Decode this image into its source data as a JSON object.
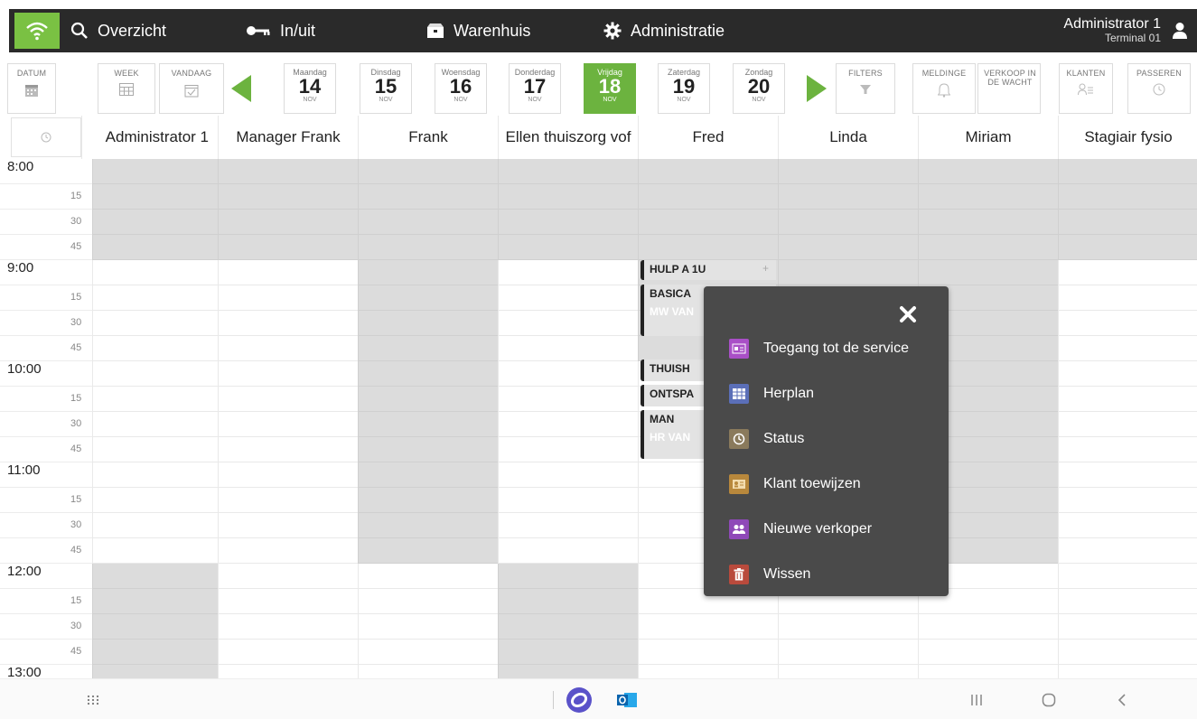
{
  "nav": {
    "items": [
      {
        "label": "Overzicht",
        "icon": "search-icon"
      },
      {
        "label": "In/uit",
        "icon": "key-icon"
      },
      {
        "label": "Warenhuis",
        "icon": "box-icon"
      },
      {
        "label": "Administratie",
        "icon": "gear-icon"
      }
    ],
    "user_name": "Administrator 1",
    "terminal": "Terminal 01"
  },
  "toolbar": {
    "datum": "DATUM",
    "week": "WEEK",
    "vandaag": "VANDAAG",
    "filters": "FILTERS",
    "meldingen": "MELDINGE",
    "verkoop": "VERKOOP IN DE WACHT",
    "klanten": "KLANTEN",
    "passeren": "PASSEREN"
  },
  "days": [
    {
      "name": "Maandag",
      "num": "14",
      "month": "NOV"
    },
    {
      "name": "Dinsdag",
      "num": "15",
      "month": "NOV"
    },
    {
      "name": "Woensdag",
      "num": "16",
      "month": "NOV"
    },
    {
      "name": "Donderdag",
      "num": "17",
      "month": "NOV"
    },
    {
      "name": "Vrijdag",
      "num": "18",
      "month": "NOV",
      "active": true
    },
    {
      "name": "Zaterdag",
      "num": "19",
      "month": "NOV"
    },
    {
      "name": "Zondag",
      "num": "20",
      "month": "NOV"
    }
  ],
  "columns": [
    "Administrator 1",
    "Manager Frank",
    "Frank",
    "Ellen thuiszorg vof",
    "Fred",
    "Linda",
    "Miriam",
    "Stagiair fysio"
  ],
  "hours": [
    "8:00",
    "9:00",
    "10:00",
    "11:00",
    "12:00",
    "13:00"
  ],
  "quarters": [
    "15",
    "30",
    "45"
  ],
  "appointments": [
    {
      "title": "HULP A 1U",
      "plus": "+"
    },
    {
      "title": "BASICA",
      "sub": "MW VAN"
    },
    {
      "title": "THUISH"
    },
    {
      "title": "ONTSPA"
    },
    {
      "title": "MAN",
      "sub": "HR VAN"
    }
  ],
  "context_menu": {
    "items": [
      {
        "label": "Toegang tot de service",
        "color": "#a94fc7"
      },
      {
        "label": "Herplan",
        "color": "#5b6fb8"
      },
      {
        "label": "Status",
        "color": "#8a7a5c"
      },
      {
        "label": "Klant toewijzen",
        "color": "#b8883c"
      },
      {
        "label": "Nieuwe verkoper",
        "color": "#8f49b8"
      },
      {
        "label": "Wissen",
        "color": "#b94a3c"
      }
    ]
  },
  "colors": {
    "accent": "#6cb33f",
    "navbar": "#2a2a2a",
    "menu_bg": "#4a4a4a",
    "unavailable": "#dcdcdc"
  }
}
